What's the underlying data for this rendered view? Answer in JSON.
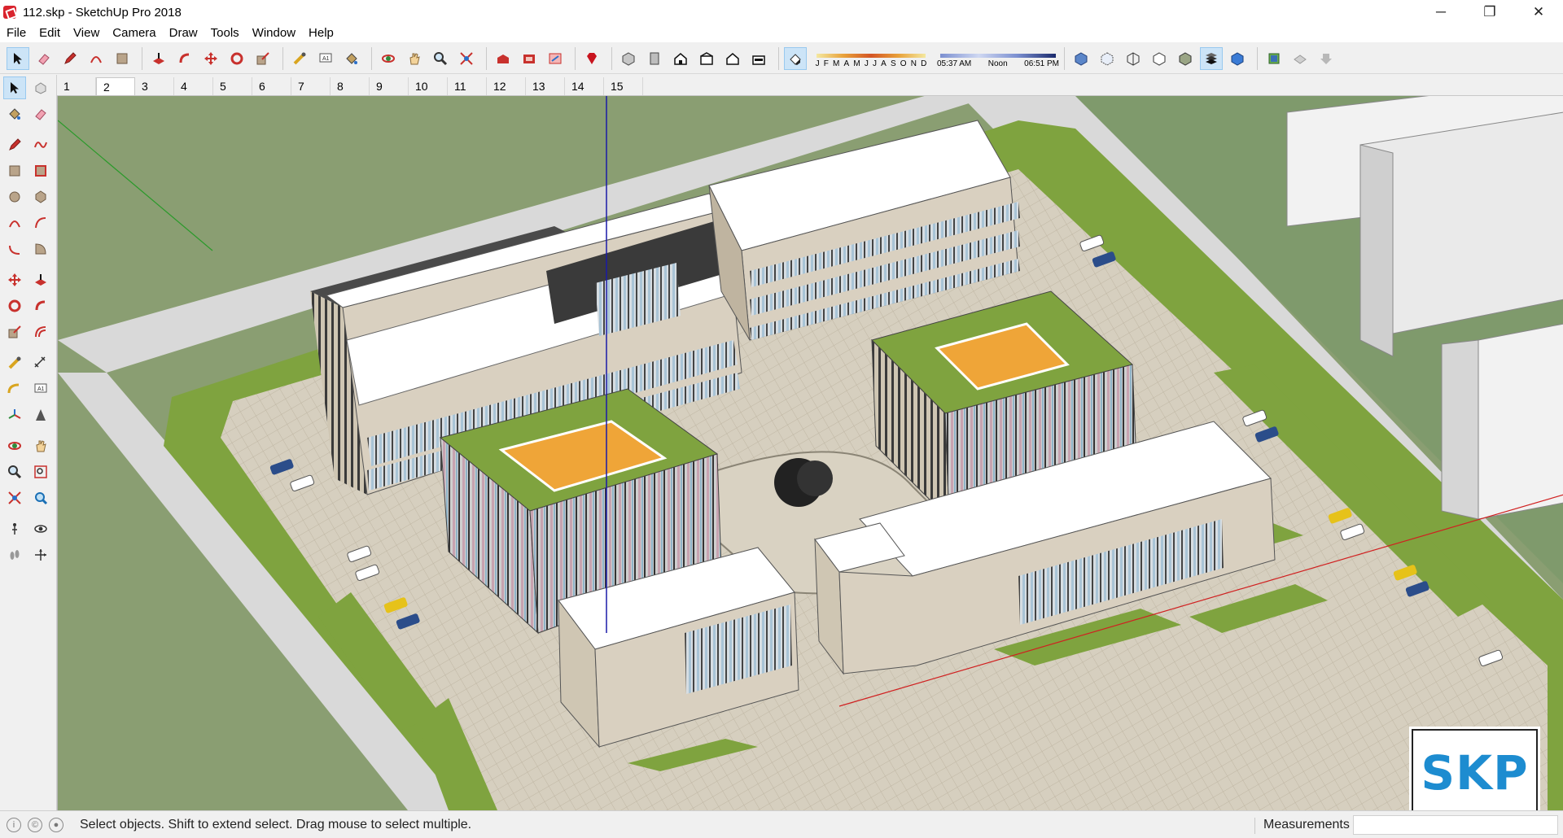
{
  "window": {
    "title": "112.skp - SketchUp Pro 2018",
    "minimize": "─",
    "restore": "❐",
    "close": "✕"
  },
  "menu": [
    "File",
    "Edit",
    "View",
    "Camera",
    "Draw",
    "Tools",
    "Window",
    "Help"
  ],
  "toolbar": {
    "shadow_months": [
      "J",
      "F",
      "M",
      "A",
      "M",
      "J",
      "J",
      "A",
      "S",
      "O",
      "N",
      "D"
    ],
    "time_start": "05:37 AM",
    "time_mid": "Noon",
    "time_end": "06:51 PM",
    "icons": [
      "select-icon",
      "eraser-icon",
      "pencil-icon",
      "arc-icon",
      "rectangle-icon",
      "push-pull-icon",
      "follow-me-icon",
      "move-icon",
      "rotate-icon",
      "scale-icon",
      "tape-measure-icon",
      "text-icon",
      "paint-bucket-icon",
      "orbit-icon",
      "pan-icon",
      "zoom-icon",
      "zoom-extents-icon",
      "3d-warehouse-icon",
      "extension-warehouse-icon",
      "layout-icon",
      "ruby-icon",
      "iso-view-icon",
      "top-view-icon",
      "front-view-icon",
      "right-view-icon",
      "back-view-icon",
      "left-view-icon",
      "shadows-icon",
      "xray-icon",
      "back-edges-icon",
      "wireframe-icon",
      "hidden-line-icon",
      "shaded-icon",
      "shaded-textures-icon",
      "monochrome-icon",
      "section-plane-icon",
      "section-cuts-icon",
      "section-fill-icon"
    ]
  },
  "left_toolbar": {
    "icons": [
      "select-icon",
      "component-icon",
      "paint-bucket-icon",
      "eraser-icon",
      "line-icon",
      "freehand-icon",
      "rectangle-icon",
      "rotated-rectangle-icon",
      "circle-icon",
      "polygon-icon",
      "arc-icon",
      "two-point-arc-icon",
      "three-point-arc-icon",
      "pie-icon",
      "move-icon",
      "push-pull-icon",
      "rotate-icon",
      "follow-me-icon",
      "scale-icon",
      "offset-icon",
      "tape-measure-icon",
      "dimension-icon",
      "protractor-icon",
      "text-icon",
      "axes-icon",
      "3d-text-icon",
      "orbit-icon",
      "pan-icon",
      "zoom-icon",
      "zoom-window-icon",
      "zoom-extents-icon",
      "previous-view-icon",
      "position-camera-icon",
      "look-around-icon",
      "walk-icon",
      "section-plane-icon"
    ]
  },
  "scenes": [
    "1",
    "2",
    "3",
    "4",
    "5",
    "6",
    "7",
    "8",
    "9",
    "10",
    "11",
    "12",
    "13",
    "14",
    "15"
  ],
  "active_scene": "2",
  "status": {
    "hint": "Select objects. Shift to extend select. Drag mouse to select multiple.",
    "measurements_label": "Measurements",
    "measurements_value": ""
  },
  "badge": {
    "text": "SKP"
  },
  "colors": {
    "ground": "#8a9e72",
    "road": "#d8d8d8",
    "lawn": "#7fa33f",
    "paving": "#d6cfbf",
    "roof": "#ffffff",
    "facade": "#d9d0c0",
    "courtyard_roof": "#efa538",
    "blue_axis": "#1a1aa8",
    "red_axis": "#d02020",
    "green_axis": "#2a9a2a"
  }
}
